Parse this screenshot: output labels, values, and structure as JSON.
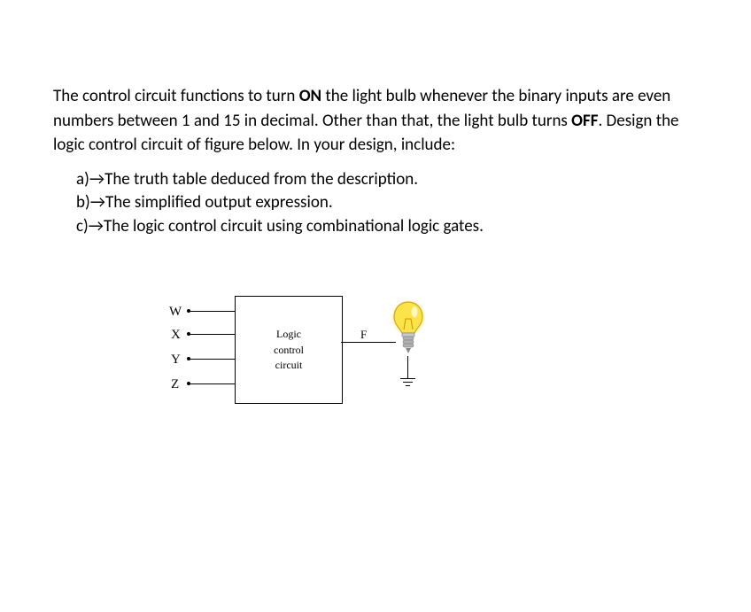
{
  "intro": {
    "part1": "The control circuit functions to turn ",
    "bold1": "ON",
    "part2": " the light bulb whenever the binary inputs are even numbers between 1 and 15 in decimal. Other than that, the light bulb turns ",
    "bold2": "OFF",
    "part3": ". Design the logic control circuit of figure below. In your design, include:"
  },
  "items": {
    "a": "a)→The truth table deduced from the description.",
    "b": "b)→The simplified output expression.",
    "c": "c)→The logic control circuit using combinational logic gates."
  },
  "diagram": {
    "inputs": {
      "w": "W",
      "x": "X",
      "y": "Y",
      "z": "Z"
    },
    "box": {
      "line1": "Logic",
      "line2": "control",
      "line3": "circuit"
    },
    "output": "F"
  }
}
